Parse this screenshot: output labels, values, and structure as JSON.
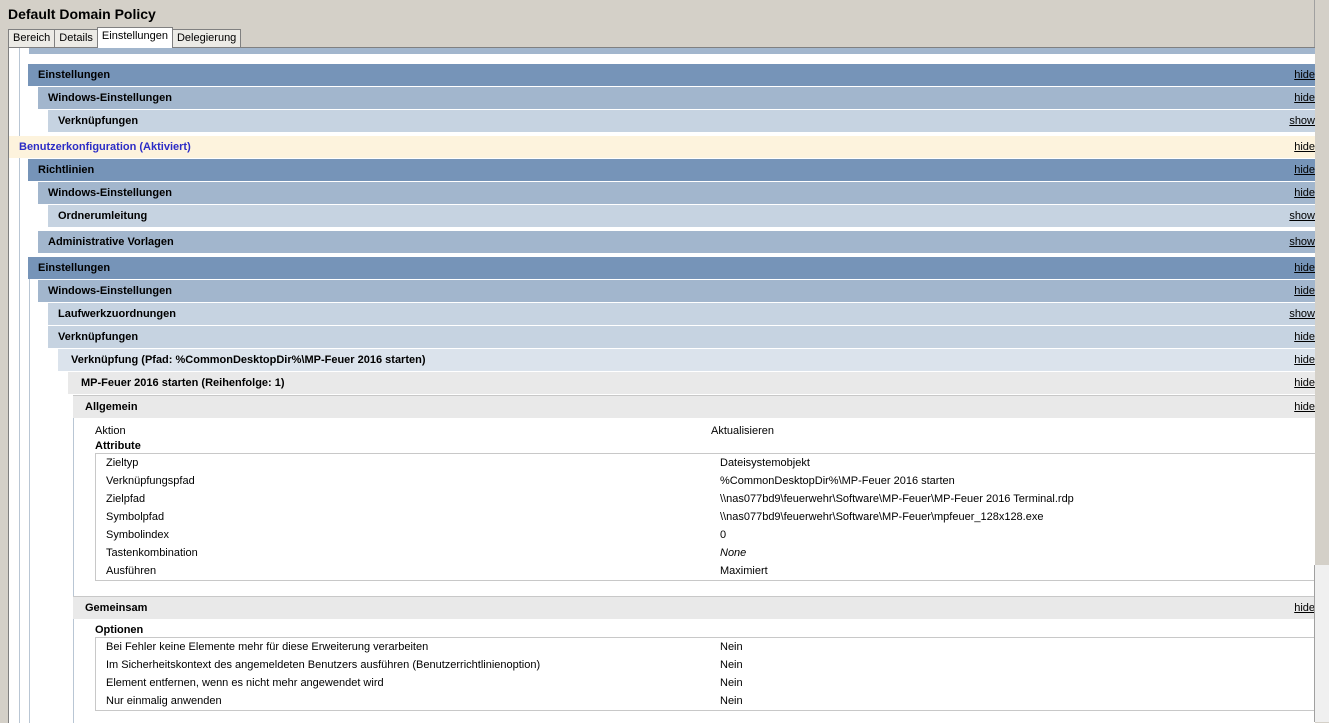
{
  "window": {
    "title": "Default Domain Policy"
  },
  "tabs": [
    {
      "label": "Bereich"
    },
    {
      "label": "Details"
    },
    {
      "label": "Einstellungen"
    },
    {
      "label": "Delegierung"
    }
  ],
  "rows": {
    "einstellungen_1": {
      "label": "Einstellungen",
      "toggle": "hide"
    },
    "windows_einstellungen_1": {
      "label": "Windows-Einstellungen",
      "toggle": "hide"
    },
    "verknuepfungen_1": {
      "label": "Verknüpfungen",
      "toggle": "show"
    },
    "benutzerkonfiguration": {
      "label": "Benutzerkonfiguration (Aktiviert)",
      "toggle": "hide"
    },
    "richtlinien": {
      "label": "Richtlinien",
      "toggle": "hide"
    },
    "windows_einstellungen_2": {
      "label": "Windows-Einstellungen",
      "toggle": "hide"
    },
    "ordnerumleitung": {
      "label": "Ordnerumleitung",
      "toggle": "show"
    },
    "administrative_vorlagen": {
      "label": "Administrative Vorlagen",
      "toggle": "show"
    },
    "einstellungen_2": {
      "label": "Einstellungen",
      "toggle": "hide"
    },
    "windows_einstellungen_3": {
      "label": "Windows-Einstellungen",
      "toggle": "hide"
    },
    "laufwerkzuordnungen": {
      "label": "Laufwerkzuordnungen",
      "toggle": "show"
    },
    "verknuepfungen_2": {
      "label": "Verknüpfungen",
      "toggle": "hide"
    },
    "verknuepfung_pfad": {
      "label": "Verknüpfung (Pfad: %CommonDesktopDir%\\MP-Feuer 2016 starten)",
      "toggle": "hide"
    },
    "mp_feuer": {
      "label": "MP-Feuer 2016 starten (Reihenfolge: 1)",
      "toggle": "hide"
    },
    "allgemein": {
      "label": "Allgemein",
      "toggle": "hide"
    },
    "gemeinsam": {
      "label": "Gemeinsam",
      "toggle": "hide"
    }
  },
  "allgemein": {
    "aktion_label": "Aktion",
    "aktion_value": "Aktualisieren",
    "attribute_heading": "Attribute",
    "attributes": [
      {
        "key": "Zieltyp",
        "value": "Dateisystemobjekt"
      },
      {
        "key": "Verknüpfungspfad",
        "value": "%CommonDesktopDir%\\MP-Feuer 2016 starten"
      },
      {
        "key": "Zielpfad",
        "value": "\\\\nas077bd9\\feuerwehr\\Software\\MP-Feuer\\MP-Feuer 2016 Terminal.rdp"
      },
      {
        "key": "Symbolpfad",
        "value": "\\\\nas077bd9\\feuerwehr\\Software\\MP-Feuer\\mpfeuer_128x128.exe"
      },
      {
        "key": "Symbolindex",
        "value": "0"
      },
      {
        "key": "Tastenkombination",
        "value": "None"
      },
      {
        "key": "Ausführen",
        "value": "Maximiert"
      }
    ]
  },
  "gemeinsam": {
    "optionen_heading": "Optionen",
    "options": [
      {
        "key": "Bei Fehler keine Elemente mehr für diese Erweiterung verarbeiten",
        "value": "Nein"
      },
      {
        "key": "Im Sicherheitskontext des angemeldeten Benutzers ausführen (Benutzerrichtlinienoption)",
        "value": "Nein"
      },
      {
        "key": "Element entfernen, wenn es nicht mehr angewendet wird",
        "value": "Nein"
      },
      {
        "key": "Nur einmalig anwenden",
        "value": "Nein"
      }
    ]
  }
}
